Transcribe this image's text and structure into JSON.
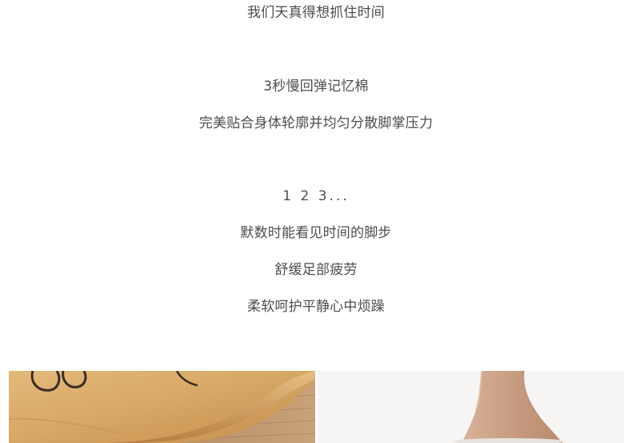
{
  "text_lines": [
    "我们天真得想抓住时间",
    "3秒慢回弹记忆棉",
    "完美贴合身体轮廓并均匀分散脚掌压力",
    "1 2 3...",
    "默数时能看见时间的脚步",
    "舒缓足部疲劳",
    "柔软呵护平静心中烦躁"
  ],
  "images": {
    "left": "slipper-closeup-photo",
    "right": "bare-foot-photo"
  }
}
